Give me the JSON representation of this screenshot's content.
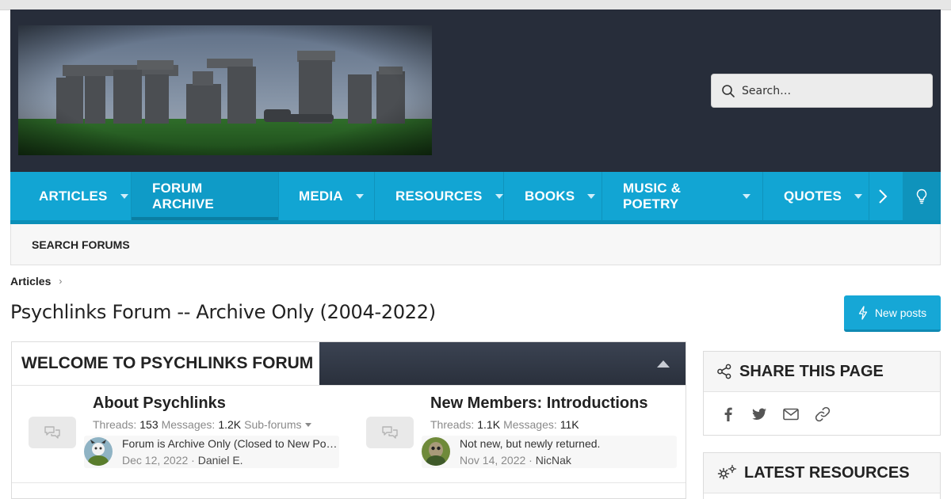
{
  "search": {
    "placeholder": "Search…"
  },
  "nav": {
    "items": [
      {
        "label": "ARTICLES"
      },
      {
        "label": "FORUM ARCHIVE"
      },
      {
        "label": "MEDIA"
      },
      {
        "label": "RESOURCES"
      },
      {
        "label": "BOOKS"
      },
      {
        "label": "MUSIC & POETRY"
      },
      {
        "label": "QUOTES"
      }
    ],
    "selected": "FORUM ARCHIVE"
  },
  "subnav": {
    "search_forums": "SEARCH FORUMS"
  },
  "breadcrumb": {
    "item": "Articles"
  },
  "page": {
    "title": "Psychlinks Forum -- Archive Only (2004-2022)"
  },
  "actions": {
    "new_posts": "New posts"
  },
  "welcome_block": {
    "title": "WELCOME TO PSYCHLINKS FORUM",
    "forums": [
      {
        "name": "About Psychlinks",
        "threads_label": "Threads:",
        "threads": "153",
        "messages_label": "Messages:",
        "messages": "1.2K",
        "subforums": "Sub-forums",
        "last_post_title": "Forum is Archive Only (Closed to New Posts)",
        "last_post_date": "Dec 12, 2022",
        "last_post_user": "Daniel E."
      },
      {
        "name": "New Members: Introductions",
        "threads_label": "Threads:",
        "threads": "1.1K",
        "messages_label": "Messages:",
        "messages": "11K",
        "last_post_title": "Not new, but newly returned.",
        "last_post_date": "Nov 14, 2022",
        "last_post_user": "NicNak"
      }
    ]
  },
  "sidebar": {
    "share_title": "SHARE THIS PAGE",
    "share_icons": [
      "facebook-icon",
      "twitter-icon",
      "email-icon",
      "link-icon"
    ],
    "resources_title": "LATEST RESOURCES"
  },
  "colors": {
    "header_bg": "#272d3a",
    "nav_bg": "#12a5d3",
    "accent": "#16a7d6"
  }
}
